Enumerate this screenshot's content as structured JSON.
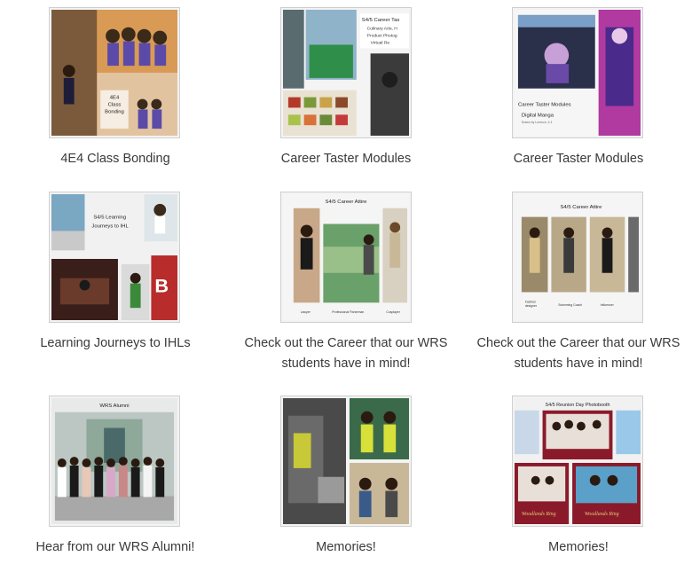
{
  "gallery": {
    "items": [
      {
        "caption": "4E4 Class Bonding",
        "overlay": "4E4\nClass\nBonding"
      },
      {
        "caption": "Career Taster Modules",
        "overlay": "S4/5 Career Taster\nCulinary Arts, H\nProduct Photog\nVirtual Re"
      },
      {
        "caption": "Career Taster Modules",
        "overlay": "Career Taster Modules\nDigital Manga"
      },
      {
        "caption": "Learning Journeys to IHLs",
        "overlay": "S4/5 Learning\nJourneys to IHL"
      },
      {
        "caption": "Check out the Career that our WRS students have in mind!",
        "overlay": "S4/5 Career Attire",
        "labels": [
          "Lawyer",
          "Professional Fisherman",
          "Cosplayer"
        ]
      },
      {
        "caption": "Check out the Career that our WRS students have in mind!",
        "overlay": "S4/5 Career Attire",
        "labels": [
          "Fashion designer",
          "Swimming Coach",
          "Influencer"
        ]
      },
      {
        "caption": "Hear from our WRS Alumni!",
        "overlay": "WRS Alumni"
      },
      {
        "caption": "Memories!",
        "overlay": ""
      },
      {
        "caption": "Memories!",
        "overlay": "S4/5 Reunion Day Photobooth"
      }
    ]
  },
  "colors": {
    "caption_text": "#3a3a3a",
    "thumb_border": "#cfcfcf"
  }
}
